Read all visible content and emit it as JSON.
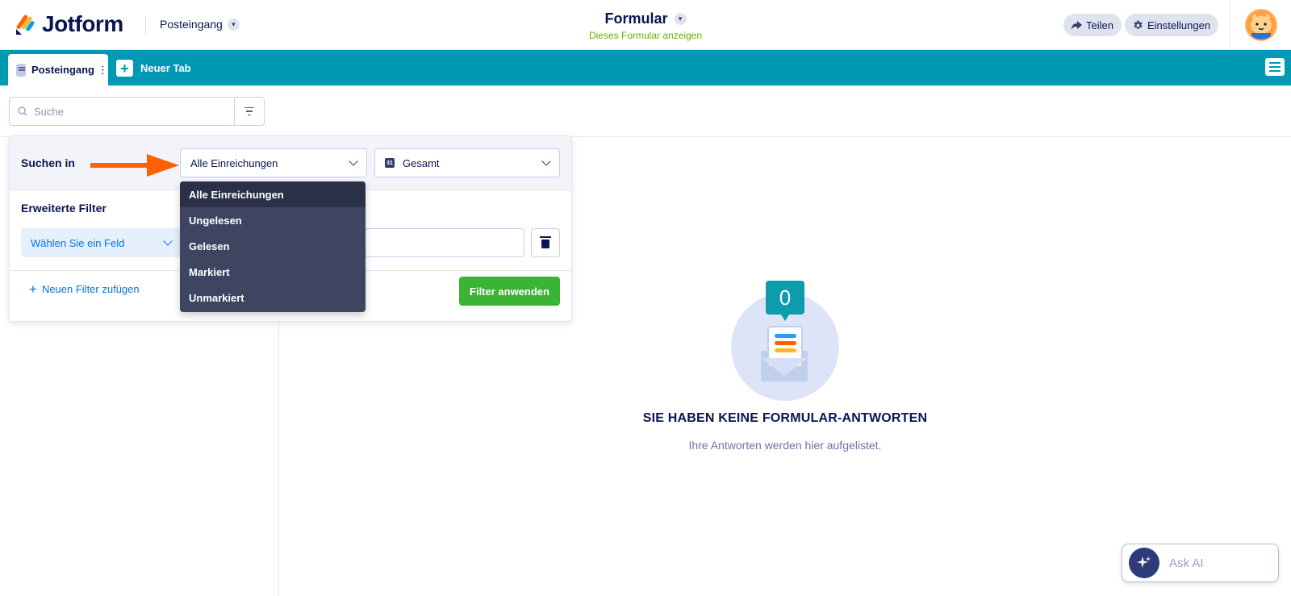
{
  "header": {
    "logo_text": "Jotform",
    "inbox_select_label": "Posteingang",
    "form_title": "Formular",
    "form_subtitle": "Dieses Formular anzeigen",
    "share_label": "Teilen",
    "settings_label": "Einstellungen"
  },
  "tabs": {
    "active_label": "Posteingang",
    "active_menu": "⋮",
    "new_tab_label": "Neuer Tab"
  },
  "search": {
    "placeholder": "Suche"
  },
  "filter_panel": {
    "search_in_label": "Suchen in",
    "search_in_value": "Alle Einreichungen",
    "date_range_value": "Gesamt",
    "calendar_icon_text": "31",
    "advanced_label": "Erweiterte Filter",
    "field_select_placeholder": "Wählen Sie ein Feld",
    "add_filter_label": "Neuen Filter zufügen",
    "apply_label": "Filter anwenden"
  },
  "dropdown": {
    "options": [
      "Alle Einreichungen",
      "Ungelesen",
      "Gelesen",
      "Markiert",
      "Unmarkiert"
    ],
    "selected_index": 0
  },
  "empty_state": {
    "count": "0",
    "title": "SIE HABEN KEINE FORMULAR-ANTWORTEN",
    "subtitle": "Ihre Antworten werden hier aufgelistet."
  },
  "ask_ai": {
    "label": "Ask AI"
  },
  "colors": {
    "tabbar": "#0099b4",
    "apply_button": "#3bb333",
    "arrow": "#ff6100",
    "dropdown_bg": "#3e4561",
    "link_blue": "#0075e3",
    "subtitle_green": "#64b200"
  },
  "icons": {
    "share": "share-arrow-icon",
    "settings": "gear-icon",
    "search": "search-icon",
    "filter": "filter-icon",
    "calendar": "calendar-icon",
    "trash": "trash-icon",
    "menu": "hamburger-icon",
    "ai": "sparkle-icon"
  }
}
